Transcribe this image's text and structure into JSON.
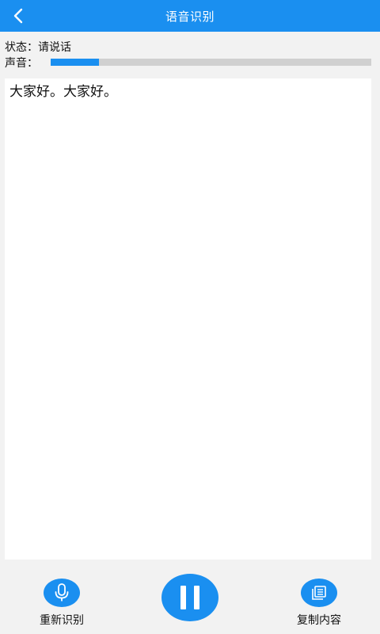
{
  "header": {
    "title": "语音识别",
    "back_icon": "chevron-left-icon"
  },
  "status": {
    "label": "状态：",
    "value": "请说话"
  },
  "volume": {
    "label": "声音：",
    "level_fraction": 0.15
  },
  "result": {
    "text": "大家好。大家好。"
  },
  "bottom": {
    "rerecognize": {
      "label": "重新识别",
      "icon": "microphone-icon"
    },
    "pause": {
      "icon": "pause-icon"
    },
    "copy": {
      "label": "复制内容",
      "icon": "copy-icon"
    }
  },
  "colors": {
    "accent": "#1a8ff0",
    "background": "#f2f2f2",
    "track": "#d0d0d0"
  }
}
